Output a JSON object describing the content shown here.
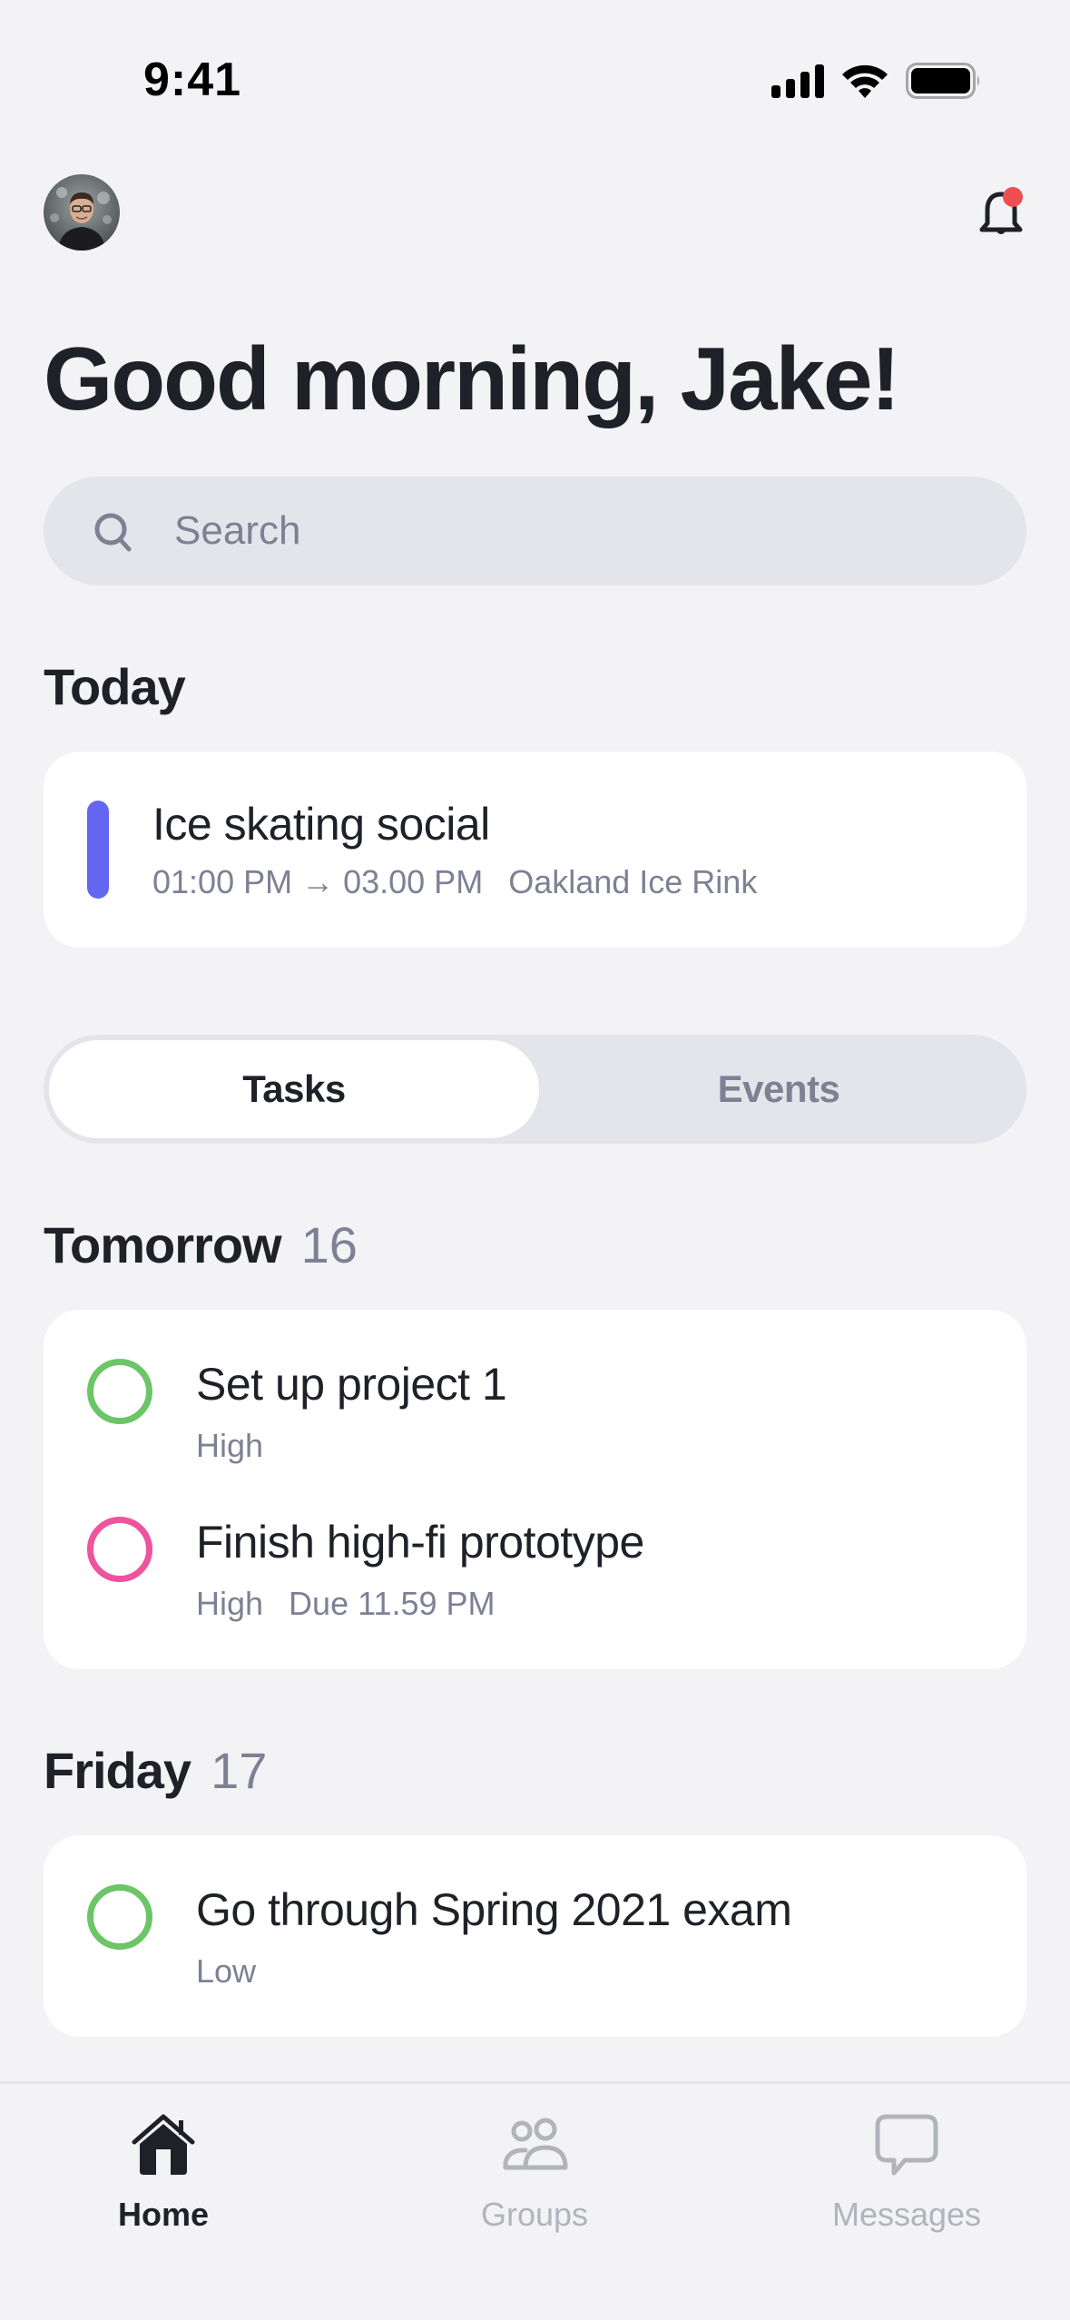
{
  "status_bar": {
    "time": "9:41",
    "icons": [
      "cellular-signal-icon",
      "wifi-icon",
      "battery-icon"
    ]
  },
  "header": {
    "avatar": "user-avatar",
    "notification_icon": "bell-icon",
    "has_unread_notifications": true
  },
  "greeting": "Good morning, Jake!",
  "search": {
    "placeholder": "Search",
    "value": ""
  },
  "today": {
    "title": "Today",
    "events": [
      {
        "title": "Ice skating social",
        "time": "01:00 PM → 03.00 PM",
        "location": "Oakland Ice Rink",
        "color": "#6366F1"
      }
    ]
  },
  "segmented": {
    "options": [
      "Tasks",
      "Events"
    ],
    "selected": "Tasks"
  },
  "groups": [
    {
      "title": "Tomorrow",
      "count": "16",
      "tasks": [
        {
          "title": "Set up project 1",
          "priority": "High",
          "due": "",
          "color": "#6CC567"
        },
        {
          "title": "Finish high-fi prototype",
          "priority": "High",
          "due": "Due 11.59 PM",
          "color": "#EE549E"
        }
      ]
    },
    {
      "title": "Friday",
      "count": "17",
      "tasks": [
        {
          "title": "Go through Spring 2021 exam",
          "priority": "Low",
          "due": "",
          "color": "#6CC567"
        }
      ]
    }
  ],
  "tabbar": {
    "items": [
      {
        "label": "Home",
        "icon": "home-icon",
        "active": true
      },
      {
        "label": "Groups",
        "icon": "groups-icon",
        "active": false
      },
      {
        "label": "Messages",
        "icon": "messages-icon",
        "active": false
      }
    ]
  },
  "colors": {
    "background": "#F3F3F5",
    "card": "#FFFFFF",
    "text_primary": "#1F2128",
    "text_secondary": "#7E8194",
    "accent_event": "#6366F1",
    "priority_green": "#6CC567",
    "priority_pink": "#EE549E",
    "notification_dot": "#EF4F50",
    "tab_inactive": "#B1B4BB"
  }
}
